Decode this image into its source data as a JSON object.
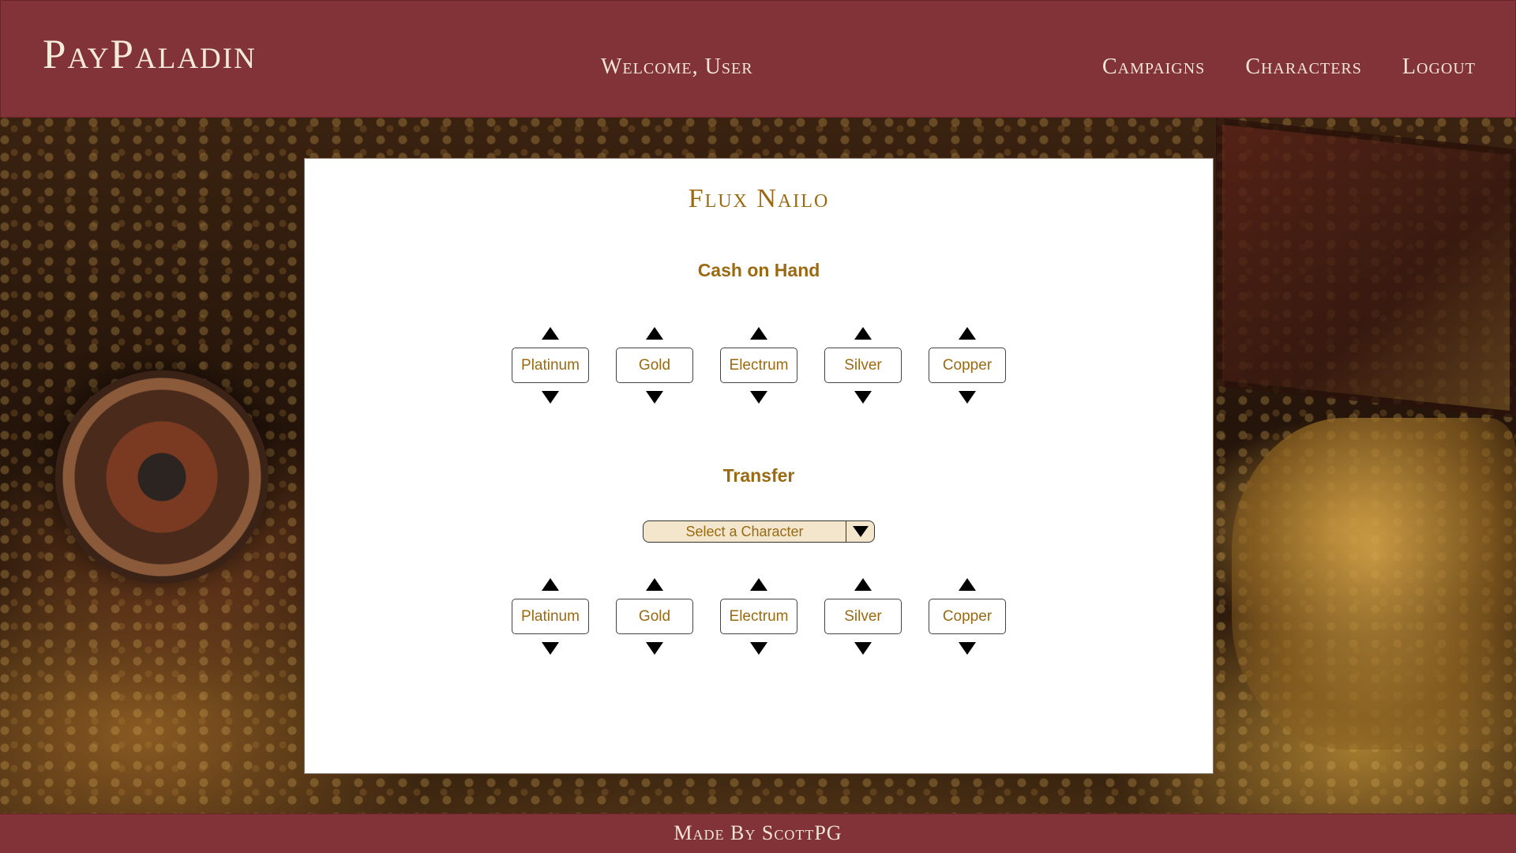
{
  "header": {
    "brand": "PayPaladin",
    "welcome": "Welcome, User",
    "nav": [
      {
        "label": "Campaigns"
      },
      {
        "label": "Characters"
      },
      {
        "label": "Logout"
      }
    ]
  },
  "character": {
    "name": "Flux Nailo"
  },
  "cash_on_hand": {
    "title": "Cash on Hand",
    "coins": [
      {
        "label": "Platinum"
      },
      {
        "label": "Gold"
      },
      {
        "label": "Electrum"
      },
      {
        "label": "Silver"
      },
      {
        "label": "Copper"
      }
    ]
  },
  "transfer": {
    "title": "Transfer",
    "select_value": "Select a Character",
    "coins": [
      {
        "label": "Platinum"
      },
      {
        "label": "Gold"
      },
      {
        "label": "Electrum"
      },
      {
        "label": "Silver"
      },
      {
        "label": "Copper"
      }
    ]
  },
  "footer": {
    "text": "Made By ScottPG"
  },
  "colors": {
    "header_bg": "#823337",
    "accent_gold": "#9a6a12",
    "select_bg": "#f3e6cc"
  }
}
